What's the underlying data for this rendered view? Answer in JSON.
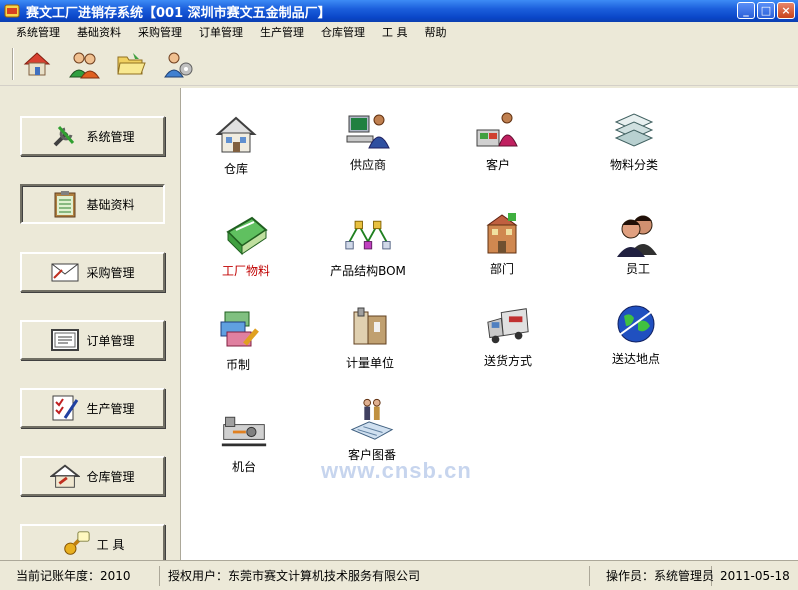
{
  "window": {
    "title": "赛文工厂进销存系统【001 深圳市赛文五金制品厂】",
    "min_label": "_",
    "max_label": "□",
    "close_label": "×"
  },
  "menu": [
    "系统管理",
    "基础资料",
    "采购管理",
    "订单管理",
    "生产管理",
    "仓库管理",
    "工 具",
    "帮助"
  ],
  "toolbar_icons": [
    "house-icon",
    "users-icon",
    "folder-open-icon",
    "user-settings-icon"
  ],
  "nav": [
    {
      "label": "系统管理",
      "icon": "tools-icon"
    },
    {
      "label": "基础资料",
      "icon": "clipboard-icon",
      "active": true
    },
    {
      "label": "采购管理",
      "icon": "envelope-icon"
    },
    {
      "label": "订单管理",
      "icon": "document-icon"
    },
    {
      "label": "生产管理",
      "icon": "checklist-icon"
    },
    {
      "label": "仓库管理",
      "icon": "warehouse-icon"
    },
    {
      "label": "工 具",
      "icon": "key-icon"
    }
  ],
  "modules": [
    {
      "label": "仓库",
      "icon": "house-icon"
    },
    {
      "label": "供应商",
      "icon": "computer-user-icon"
    },
    {
      "label": "客户",
      "icon": "customer-icon"
    },
    {
      "label": "物料分类",
      "icon": "stack-icon"
    },
    {
      "label": "工厂物料",
      "icon": "book-icon",
      "selected": true
    },
    {
      "label": "产品结构BOM",
      "icon": "tree-icon"
    },
    {
      "label": "部门",
      "icon": "department-icon"
    },
    {
      "label": "员工",
      "icon": "people-icon"
    },
    {
      "label": "币制",
      "icon": "currency-icon"
    },
    {
      "label": "计量单位",
      "icon": "measure-icon"
    },
    {
      "label": "送货方式",
      "icon": "truck-icon"
    },
    {
      "label": "送达地点",
      "icon": "globe-icon"
    },
    {
      "label": "机台",
      "icon": "machine-icon"
    },
    {
      "label": "客户图番",
      "icon": "blueprint-icon"
    }
  ],
  "watermark": "www.cnsb.cn",
  "status": {
    "year": "当前记账年度：2010",
    "license": "授权用户：东莞市赛文计算机技术服务有限公司",
    "operator": "操作员：系统管理员",
    "date": "2011-05-18"
  },
  "colors": {
    "titlebar": "#0a46c8",
    "face": "#ece9d8",
    "selected_text": "#c00000"
  }
}
